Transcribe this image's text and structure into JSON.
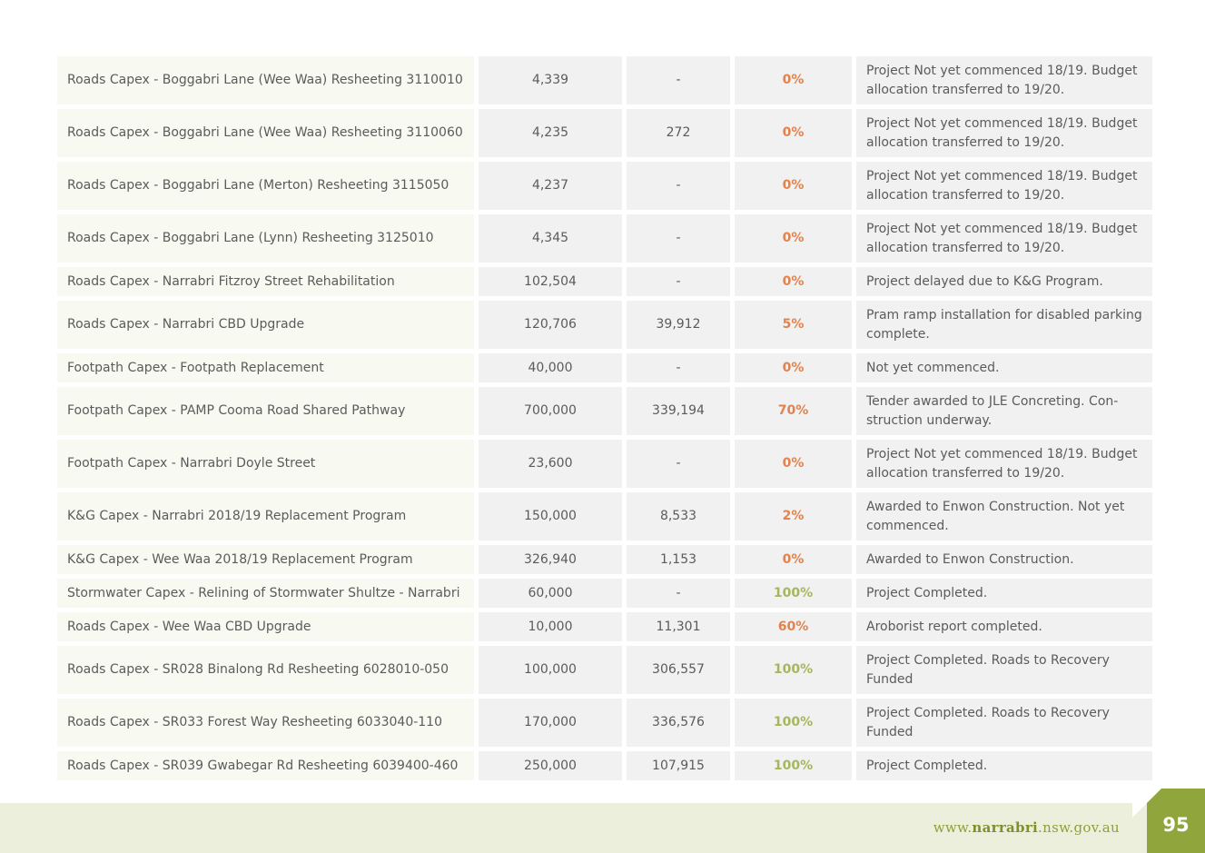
{
  "rows": [
    {
      "project": "Roads Capex - Boggabri Lane (Wee Waa) Resheeting 3110010",
      "budget": "4,339",
      "actual": "-",
      "percent": "0%",
      "comment": "Project Not yet commenced 18/19. Budget allocation transferred to 19/20."
    },
    {
      "project": "Roads Capex - Boggabri Lane (Wee Waa) Resheeting 3110060",
      "budget": "4,235",
      "actual": "272",
      "percent": "0%",
      "comment": "Project Not yet commenced 18/19. Budget allocation transferred to 19/20."
    },
    {
      "project": "Roads Capex - Boggabri Lane (Merton) Resheeting 3115050",
      "budget": "4,237",
      "actual": "-",
      "percent": "0%",
      "comment": "Project Not yet commenced 18/19. Budget allocation transferred to 19/20."
    },
    {
      "project": "Roads Capex - Boggabri Lane (Lynn) Resheeting 3125010",
      "budget": "4,345",
      "actual": "-",
      "percent": "0%",
      "comment": "Project Not yet commenced 18/19. Budget allocation transferred to 19/20."
    },
    {
      "project": "Roads Capex - Narrabri Fitzroy Street Rehabilitation",
      "budget": "102,504",
      "actual": "-",
      "percent": "0%",
      "comment": "Project delayed due to K&G Program."
    },
    {
      "project": "Roads Capex - Narrabri CBD Upgrade",
      "budget": "120,706",
      "actual": "39,912",
      "percent": "5%",
      "comment": "Pram ramp installation for disabled parking complete."
    },
    {
      "project": "Footpath Capex - Footpath Replacement",
      "budget": "40,000",
      "actual": "-",
      "percent": "0%",
      "comment": "Not yet commenced."
    },
    {
      "project": "Footpath Capex - PAMP Cooma Road Shared Pathway",
      "budget": "700,000",
      "actual": "339,194",
      "percent": "70%",
      "comment": "Tender awarded to JLE Concreting. Con-struction underway."
    },
    {
      "project": "Footpath Capex - Narrabri Doyle Street",
      "budget": "23,600",
      "actual": "-",
      "percent": "0%",
      "comment": "Project Not yet commenced 18/19. Budget allocation transferred to 19/20."
    },
    {
      "project": "K&G Capex - Narrabri 2018/19 Replacement Program",
      "budget": "150,000",
      "actual": "8,533",
      "percent": "2%",
      "comment": "Awarded to Enwon Construction. Not yet commenced."
    },
    {
      "project": "K&G Capex - Wee Waa 2018/19 Replacement Program",
      "budget": "326,940",
      "actual": "1,153",
      "percent": "0%",
      "comment": "Awarded to Enwon Construction."
    },
    {
      "project": "Stormwater Capex - Relining of Stormwater Shultze - Narrabri",
      "budget": "60,000",
      "actual": "-",
      "percent": "100%",
      "comment": "Project Completed."
    },
    {
      "project": "Roads Capex - Wee Waa CBD Upgrade",
      "budget": "10,000",
      "actual": "11,301",
      "percent": "60%",
      "comment": "Aroborist report completed."
    },
    {
      "project": "Roads Capex - SR028 Binalong Rd Resheeting 6028010-050",
      "budget": "100,000",
      "actual": "306,557",
      "percent": "100%",
      "comment": "Project Completed. Roads to Recovery Funded"
    },
    {
      "project": "Roads Capex - SR033 Forest Way Resheeting 6033040-110",
      "budget": "170,000",
      "actual": "336,576",
      "percent": "100%",
      "comment": "Project Completed. Roads to Recovery Funded"
    },
    {
      "project": "Roads Capex - SR039 Gwabegar Rd Resheeting 6039400-460",
      "budget": "250,000",
      "actual": "107,915",
      "percent": "100%",
      "comment": "Project Completed."
    }
  ],
  "footer": {
    "url_prefix": "www.",
    "url_brand": "narrabri",
    "url_suffix": ".nsw.gov.au",
    "page_number": "95"
  },
  "colors": {
    "percent_in_progress": "#e2834f",
    "percent_complete": "#a5b65f",
    "accent_green": "#90a53c"
  }
}
